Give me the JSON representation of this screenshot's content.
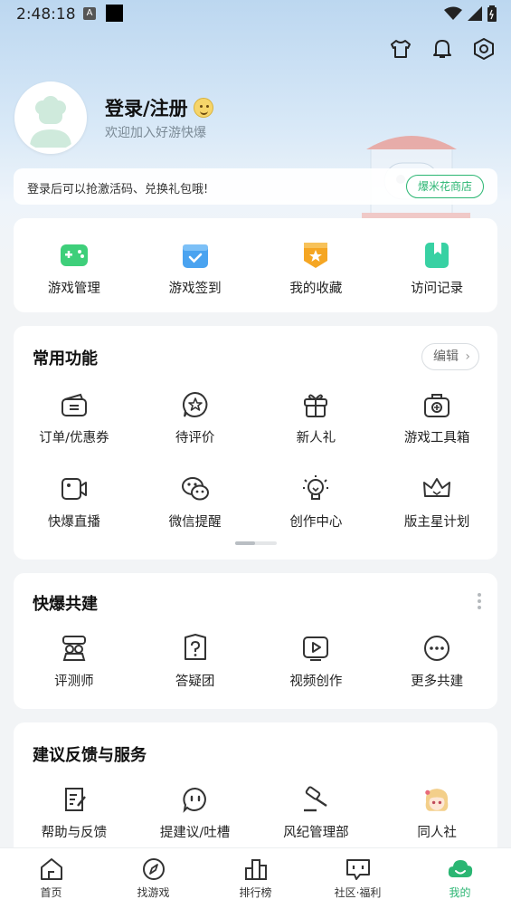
{
  "status_bar": {
    "time": "2:48:18",
    "indicator_a": "A"
  },
  "top_icons": [
    "shirt-icon",
    "bell-icon",
    "settings-hex-icon"
  ],
  "profile": {
    "title": "登录/注册",
    "subtitle": "欢迎加入好游快爆"
  },
  "promo": {
    "text": "登录后可以抢激活码、兑换礼包哦!",
    "button": "爆米花商店"
  },
  "quick_entries": [
    {
      "label": "游戏管理",
      "icon": "gamepad-icon",
      "color": "#3ecf7a"
    },
    {
      "label": "游戏签到",
      "icon": "calendar-check-icon",
      "color": "#4aa3f0"
    },
    {
      "label": "我的收藏",
      "icon": "star-badge-icon",
      "color": "#f5a623"
    },
    {
      "label": "访问记录",
      "icon": "bookmark-icon",
      "color": "#38d1a3"
    }
  ],
  "common": {
    "title": "常用功能",
    "edit_label": "编辑",
    "items": [
      {
        "label": "订单/优惠券",
        "icon": "wallet-icon"
      },
      {
        "label": "待评价",
        "icon": "star-chat-icon"
      },
      {
        "label": "新人礼",
        "icon": "gift-icon"
      },
      {
        "label": "游戏工具箱",
        "icon": "toolbox-icon"
      },
      {
        "label": "快爆直播",
        "icon": "video-camera-icon"
      },
      {
        "label": "微信提醒",
        "icon": "wechat-icon"
      },
      {
        "label": "创作中心",
        "icon": "lightbulb-icon"
      },
      {
        "label": "版主星计划",
        "icon": "crown-icon"
      }
    ]
  },
  "cobuild": {
    "title": "快爆共建",
    "items": [
      {
        "label": "评测师",
        "icon": "reviewer-icon"
      },
      {
        "label": "答疑团",
        "icon": "question-shield-icon"
      },
      {
        "label": "视频创作",
        "icon": "video-play-icon"
      },
      {
        "label": "更多共建",
        "icon": "more-circle-icon"
      }
    ]
  },
  "feedback": {
    "title": "建议反馈与服务",
    "items": [
      {
        "label": "帮助与反馈",
        "icon": "help-doc-icon"
      },
      {
        "label": "提建议/吐槽",
        "icon": "chat-bubble-icon"
      },
      {
        "label": "风纪管理部",
        "icon": "gavel-icon"
      },
      {
        "label": "同人社",
        "icon": "anime-avatar-icon"
      }
    ]
  },
  "bottom_nav": [
    {
      "label": "首页",
      "icon": "home-icon",
      "active": false
    },
    {
      "label": "找游戏",
      "icon": "compass-icon",
      "active": false
    },
    {
      "label": "排行榜",
      "icon": "ranking-icon",
      "active": false
    },
    {
      "label": "社区·福利",
      "icon": "community-icon",
      "active": false
    },
    {
      "label": "我的",
      "icon": "mine-cloud-icon",
      "active": true
    }
  ],
  "colors": {
    "accent": "#2bb673",
    "background": "#f2f4f6"
  }
}
